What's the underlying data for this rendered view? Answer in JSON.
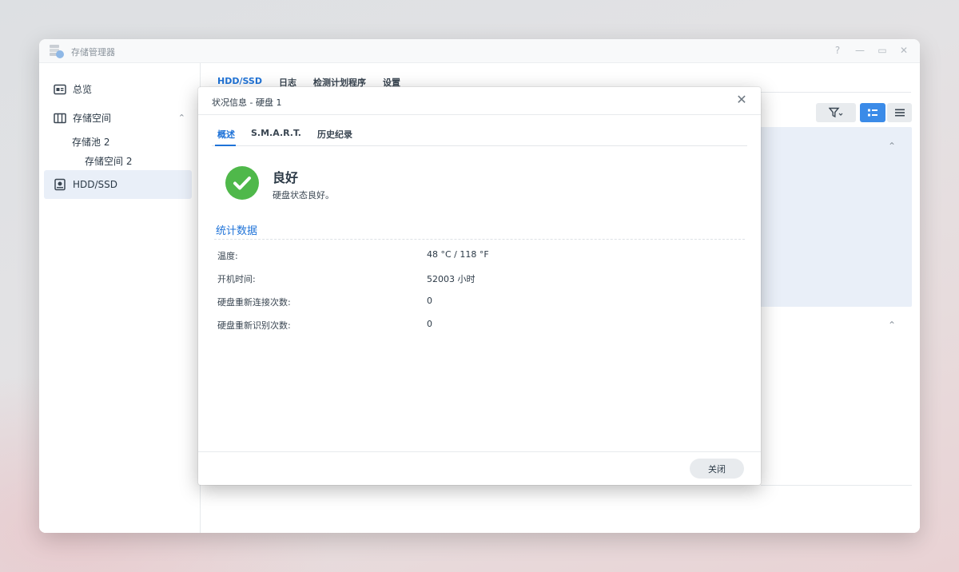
{
  "window": {
    "title": "存储管理器",
    "controls": [
      "?",
      "—",
      "▭",
      "✕"
    ]
  },
  "sidebar": {
    "items": [
      {
        "label": "总览",
        "icon": "overview-icon"
      },
      {
        "label": "存储空间",
        "icon": "storage-icon"
      },
      {
        "label": "存储池 2"
      },
      {
        "label": "存储空间 2"
      },
      {
        "label": "HDD/SSD",
        "icon": "disk-icon",
        "active": true
      }
    ]
  },
  "main": {
    "tabs": [
      {
        "label": "HDD/SSD",
        "active": true
      },
      {
        "label": "日志"
      },
      {
        "label": "检测计划程序"
      },
      {
        "label": "设置"
      }
    ]
  },
  "dialog": {
    "title": "状况信息 - 硬盘 1",
    "tabs": [
      {
        "label": "概述",
        "active": true
      },
      {
        "label": "S.M.A.R.T."
      },
      {
        "label": "历史纪录"
      }
    ],
    "status": {
      "title": "良好",
      "subtitle": "硬盘状态良好。",
      "color": "#4fb84a"
    },
    "section_title": "统计数据",
    "stats": [
      {
        "label": "温度:",
        "value": "48 °C / 118 °F"
      },
      {
        "label": "开机时间:",
        "value": "52003 小时"
      },
      {
        "label": "硬盘重新连接次数:",
        "value": "0"
      },
      {
        "label": "硬盘重新识别次数:",
        "value": "0"
      }
    ],
    "close_label": "关闭"
  },
  "colors": {
    "accent": "#1f73d8",
    "success": "#4fb84a",
    "active_bg": "#e9eff8"
  }
}
